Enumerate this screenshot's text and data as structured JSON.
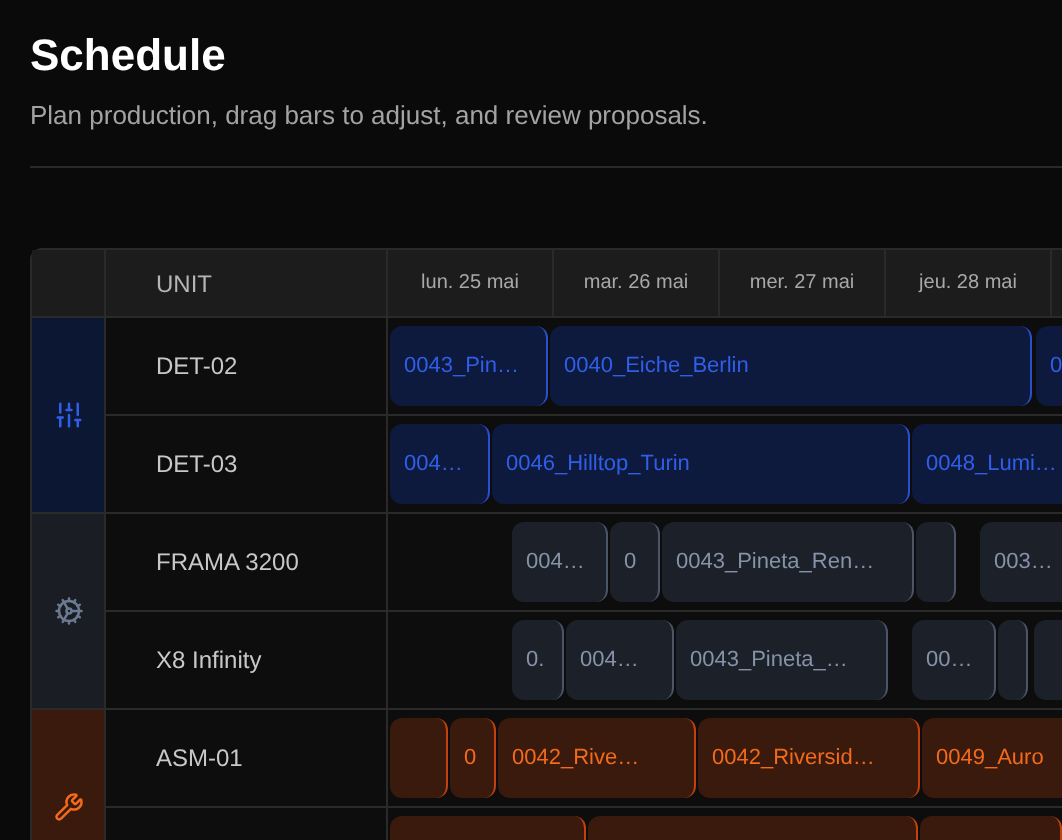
{
  "title": "Schedule",
  "subtitle": "Plan production, drag bars to adjust, and review proposals.",
  "table": {
    "unit_header": "UNIT",
    "days": [
      "lun. 25 mai",
      "mar. 26 mai",
      "mer. 27 mai",
      "jeu. 28 mai"
    ],
    "groups": [
      {
        "kind": "detail",
        "units": [
          {
            "name": "DET-02",
            "bars": [
              {
                "kind": "block",
                "label": "0043_Pin…"
              },
              {
                "kind": "block",
                "label": "0040_Eiche_Berlin"
              },
              {
                "kind": "block",
                "label": "0"
              }
            ]
          },
          {
            "name": "DET-03",
            "bars": [
              {
                "kind": "block",
                "label": "004…"
              },
              {
                "kind": "block",
                "label": "0046_Hilltop_Turin"
              },
              {
                "kind": "block",
                "label": "0048_Lumi…"
              }
            ]
          }
        ]
      },
      {
        "kind": "frame",
        "units": [
          {
            "name": "FRAMA 3200",
            "bars": [
              {
                "kind": "block",
                "label": "004…"
              },
              {
                "kind": "block",
                "label": "0"
              },
              {
                "kind": "block",
                "label": "0043_Pineta_Ren…"
              },
              {
                "kind": "block"
              },
              {
                "kind": "block",
                "label": "003…"
              }
            ]
          },
          {
            "name": "X8 Infinity",
            "bars": [
              {
                "kind": "block",
                "label": "0."
              },
              {
                "kind": "block",
                "label": "004…"
              },
              {
                "kind": "block",
                "label": "0043_Pineta_…"
              },
              {
                "kind": "block",
                "label": "00…"
              },
              {
                "kind": "block"
              },
              {
                "kind": "block"
              }
            ]
          }
        ]
      },
      {
        "kind": "assembly",
        "units": [
          {
            "name": "ASM-01",
            "bars": [
              {
                "kind": "block"
              },
              {
                "kind": "block",
                "label": "0"
              },
              {
                "kind": "block",
                "label": "0042_Rive…"
              },
              {
                "kind": "block",
                "label": "0042_Riversid…"
              },
              {
                "kind": "block",
                "label": "0049_Auro"
              }
            ]
          },
          {
            "bars": [
              {
                "kind": "block"
              },
              {
                "kind": "block"
              },
              {
                "kind": "block"
              }
            ]
          }
        ]
      }
    ]
  }
}
